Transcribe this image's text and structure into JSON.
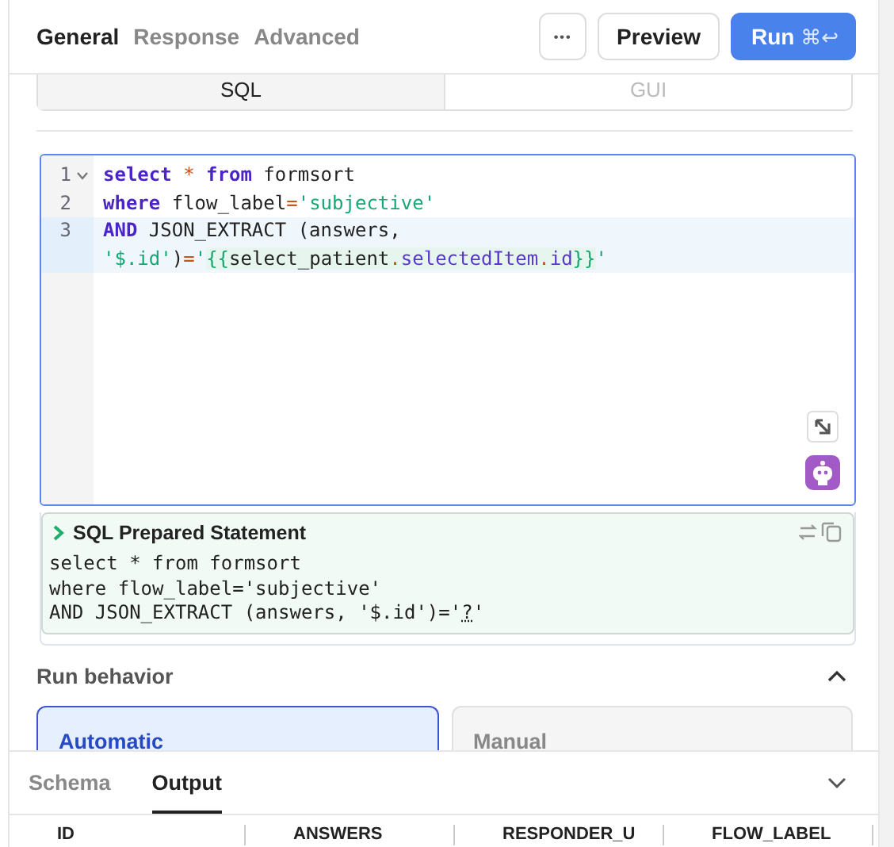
{
  "header": {
    "tabs": [
      {
        "label": "General",
        "selected": true
      },
      {
        "label": "Response",
        "selected": false
      },
      {
        "label": "Advanced",
        "selected": false
      }
    ],
    "more_button": "•••",
    "preview_button": "Preview",
    "run_button": {
      "label": "Run",
      "shortcut": "⌘↩"
    }
  },
  "mode_toggle": [
    {
      "label": "SQL",
      "selected": true
    },
    {
      "label": "GUI",
      "selected": false
    }
  ],
  "editor": {
    "lines": [
      {
        "number": "1",
        "foldable": true,
        "active": false,
        "tokens": [
          {
            "kind": "keyword",
            "text": "select"
          },
          {
            "kind": "operator",
            "text": " * "
          },
          {
            "kind": "keyword",
            "text": "from"
          },
          {
            "kind": "plain",
            "text": " formsort"
          }
        ]
      },
      {
        "number": "2",
        "foldable": false,
        "active": false,
        "tokens": [
          {
            "kind": "keyword",
            "text": "where"
          },
          {
            "kind": "plain",
            "text": " flow_label"
          },
          {
            "kind": "operator",
            "text": "="
          },
          {
            "kind": "string",
            "text": "'subjective'"
          }
        ]
      },
      {
        "number": "3",
        "foldable": false,
        "active": true,
        "tokens": [
          {
            "kind": "keyword",
            "text": "AND"
          },
          {
            "kind": "plain",
            "text": " JSON_EXTRACT (answers, "
          },
          {
            "kind": "string",
            "text": "'$.id'"
          },
          {
            "kind": "plain",
            "text": ")"
          },
          {
            "kind": "operator",
            "text": "="
          },
          {
            "kind": "string",
            "text": "'"
          },
          {
            "kind": "template-brace",
            "text": "{{"
          },
          {
            "kind": "template-var",
            "text": "select_patient"
          },
          {
            "kind": "template-dot",
            "text": "."
          },
          {
            "kind": "template-prop",
            "text": "selectedItem"
          },
          {
            "kind": "template-dot",
            "text": "."
          },
          {
            "kind": "template-prop",
            "text": "id"
          },
          {
            "kind": "template-brace",
            "text": "}}"
          },
          {
            "kind": "string",
            "text": "'"
          }
        ]
      }
    ]
  },
  "prepared_statement": {
    "title": "SQL Prepared Statement",
    "expanded": true,
    "lines": [
      [
        {
          "kind": "plain",
          "text": "select * from formsort"
        }
      ],
      [
        {
          "kind": "plain",
          "text": "where flow_label='subjective'"
        }
      ],
      [
        {
          "kind": "plain",
          "text": "AND JSON_EXTRACT (answers, '$.id')='"
        },
        {
          "kind": "param",
          "text": "?"
        },
        {
          "kind": "plain",
          "text": "'"
        }
      ]
    ]
  },
  "run_behavior": {
    "title": "Run behavior",
    "expanded": true,
    "options": [
      {
        "label": "Automatic",
        "selected": true
      },
      {
        "label": "Manual",
        "selected": false
      }
    ]
  },
  "bottom_panel": {
    "tabs": [
      {
        "label": "Schema",
        "selected": false
      },
      {
        "label": "Output",
        "selected": true
      }
    ],
    "expanded": true,
    "columns": [
      "ID",
      "ANSWERS",
      "RESPONDER_U",
      "FLOW_LABEL"
    ]
  }
}
